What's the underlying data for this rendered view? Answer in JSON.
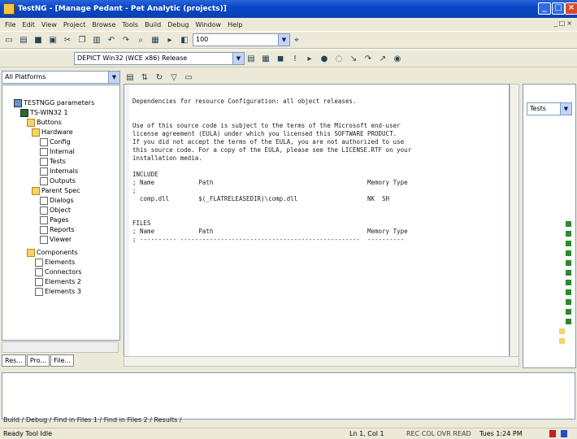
{
  "window": {
    "title": "TestNG - [Manage Pedant - Pet Analytic (projects)]"
  },
  "menubar": {
    "items": [
      "File",
      "Edit",
      "View",
      "Project",
      "Browse",
      "Tools",
      "Build",
      "Debug",
      "Window",
      "Help"
    ]
  },
  "toolbar1": {
    "zoom": "100"
  },
  "toolbar2": {
    "config": "DEPICT Win32 (WCE x86) Release"
  },
  "leftpane": {
    "combo": "All Platforms",
    "tree": [
      "TESTNGG parameters",
      "TS-WIN32 1",
      "Buttons",
      "Hardware",
      "Config",
      "Internal",
      "Tests",
      "Internals",
      "Outputs",
      "Parent Spec",
      "Dialogs",
      "Object",
      "Pages",
      "Reports",
      "Viewer",
      "Components",
      "Elements",
      "Connectors",
      "Elements 2",
      "Elements 3"
    ],
    "tabs": [
      "Res...",
      "Pro...",
      "File..."
    ]
  },
  "editor": {
    "code": [
      "Dependencies for resource Configuration: all object releases.",
      "",
      "",
      "Use of this source code is subject to the terms of the Microsoft end-user",
      "license agreement (EULA) under which you licensed this SOFTWARE PRODUCT.",
      "If you did not accept the terms of the EULA, you are not authorized to use",
      "this source code. For a copy of the EULA, please see the LICENSE.RTF on your",
      "installation media.",
      "",
      "INCLUDE",
      "; Name            Path                                          Memory Type",
      ";",
      "  comp.dll        $(_FLATRELEASEDIR)\\comp.dll                   NK  SH",
      "",
      "",
      "FILES",
      "; Name            Path                                          Memory Type",
      "; ---------- -------------------------------------------------  ----------"
    ]
  },
  "rightpane": {
    "combo": "Tests"
  },
  "output": {
    "tabs": "Build / Debug / Find in Files 1 / Find in Files 2 / Results /"
  },
  "statusbar": {
    "ready": "Ready  Tool Idle",
    "position": "Ln 1, Col 1",
    "encoding": "REC  COL  OVR  READ",
    "time": "Tues 1:24 PM"
  }
}
